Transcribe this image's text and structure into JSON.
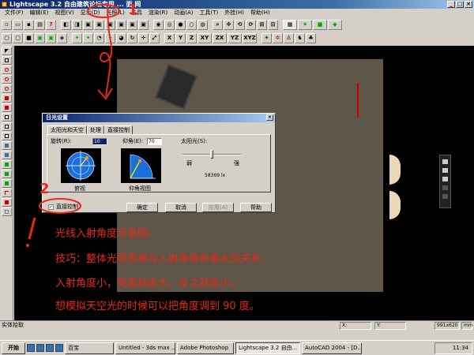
{
  "window": {
    "title": "Lightscape 3.2 自由建筑论坛专用 ... 面 网"
  },
  "menu": [
    "文件(F)",
    "编辑(E)",
    "视图(V)",
    "显示(D)",
    "光照(L)",
    "工具",
    "渲染(R)",
    "动画(A)",
    "工具(T)",
    "外挂(H)",
    "帮助(H)"
  ],
  "toolbar2": {
    "axis_buttons": [
      "X",
      "Y",
      "Z",
      "XY",
      "ZX",
      "YZ",
      "XYZ"
    ]
  },
  "dialog": {
    "title": "日光设置",
    "tabs": [
      "太阳光和天空",
      "处理",
      "直接控制"
    ],
    "active_tab": "直接控制",
    "rotation_label": "旋转(R):",
    "rotation_value": "10",
    "elevation_label": "仰角(E):",
    "elevation_value": "70",
    "sunlight_label": "太阳光(S):",
    "slider_min": "弱",
    "slider_max": "强",
    "illuminance": "58369 lx",
    "top_view_label": "俯视",
    "elevation_view_label": "仰角视图",
    "direct_control_checkbox": "直接控制",
    "direct_control_checked": true,
    "buttons": {
      "ok": "确定",
      "cancel": "取消",
      "apply": "应用(A)",
      "help": "帮助"
    }
  },
  "notes": [
    "光线入射角度示意图。",
    "技巧：整体光照亮度与入射角度有很大的关系，",
    "入射角度小，亮度就会大，反之就变小。",
    "想模拟天空光的时候可以把角度调到 90 度。"
  ],
  "annotations": {
    "step2": "2",
    "exclaim": "!"
  },
  "statusbar": {
    "text": "实体拾取",
    "x": "X:",
    "y": "Y:",
    "size": "991x620",
    "unit": "mm"
  },
  "taskbar": {
    "start": "开始",
    "tasks": [
      "百宝",
      "Untitled - 3ds max ...",
      "Adobe Photoshop",
      "Lightscape 3.2 自由...",
      "AutoCAD 2004 - [D..."
    ],
    "active_task": "Lightscape 3.2 自由...",
    "clock": "11:34"
  },
  "colors": {
    "annotation_red": "#e8281a",
    "title_blue": "#0a246a",
    "room_floor": "#5e5649"
  }
}
